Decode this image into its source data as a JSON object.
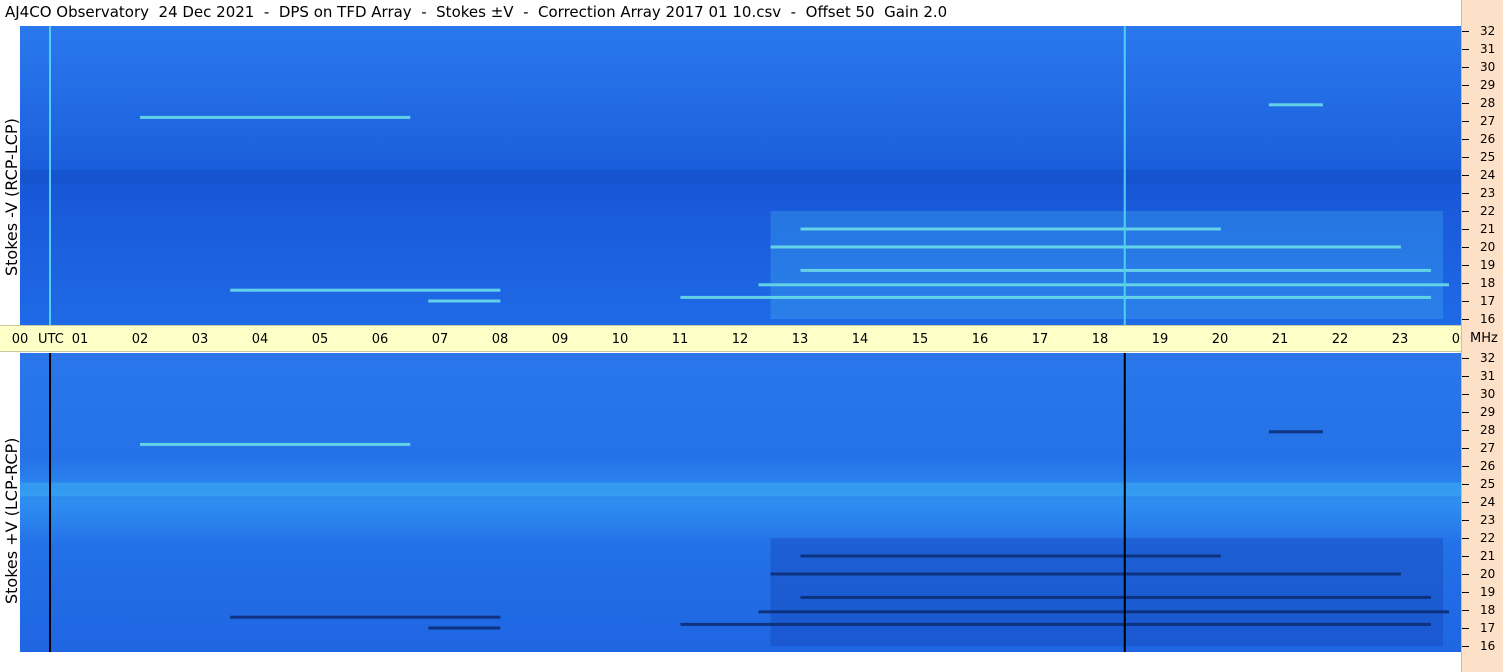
{
  "title": "AJ4CO Observatory  24 Dec 2021  -  DPS on TFD Array  -  Stokes ±V  -  Correction Array 2017 01 10.csv  -  Offset 50  Gain 2.0",
  "panels": [
    {
      "label": "Stokes -V (RCP-LCP)",
      "marker_color": "#4fd0f0",
      "base_color": "#1b62e6"
    },
    {
      "label": "Stokes +V (LCP-RCP)",
      "marker_color": "#000000",
      "base_color": "#1b62e6"
    }
  ],
  "time_axis": {
    "unit_label": "UTC",
    "hours": [
      "00",
      "01",
      "02",
      "03",
      "04",
      "05",
      "06",
      "07",
      "08",
      "09",
      "10",
      "11",
      "12",
      "13",
      "14",
      "15",
      "16",
      "17",
      "18",
      "19",
      "20",
      "21",
      "22",
      "23",
      "00"
    ]
  },
  "freq_axis": {
    "unit_label": "MHz",
    "labels": [
      "32",
      "31",
      "30",
      "29",
      "28",
      "27",
      "26",
      "25",
      "24",
      "23",
      "22",
      "21",
      "20",
      "19",
      "18",
      "17",
      "16"
    ]
  },
  "chart_data": [
    {
      "type": "heatmap",
      "title": "Stokes -V (RCP-LCP)",
      "xlabel": "UTC",
      "ylabel": "MHz",
      "xlim": [
        0,
        24
      ],
      "ylim": [
        16,
        32
      ],
      "marker_lines_utc": [
        0.5,
        18.4
      ],
      "bands": [
        {
          "utc": [
            0.0,
            24.0
          ],
          "mhz": 23.9,
          "level": "low"
        },
        {
          "utc": [
            3.5,
            8.0
          ],
          "mhz": 17.6,
          "level": "high"
        },
        {
          "utc": [
            6.8,
            8.0
          ],
          "mhz": 17.0,
          "level": "high"
        },
        {
          "utc": [
            12.3,
            23.8
          ],
          "mhz": 17.9,
          "level": "high"
        },
        {
          "utc": [
            11.0,
            23.5
          ],
          "mhz": 17.2,
          "level": "high"
        },
        {
          "utc": [
            13.0,
            23.5
          ],
          "mhz": 18.7,
          "level": "high"
        },
        {
          "utc": [
            12.5,
            23.0
          ],
          "mhz": 20.0,
          "level": "high"
        },
        {
          "utc": [
            13.0,
            20.0
          ],
          "mhz": 21.0,
          "level": "high"
        },
        {
          "utc": [
            20.8,
            21.7
          ],
          "mhz": 27.9,
          "level": "high"
        },
        {
          "utc": [
            2.0,
            6.5
          ],
          "mhz": 27.2,
          "level": "high"
        }
      ]
    },
    {
      "type": "heatmap",
      "title": "Stokes +V (LCP-RCP)",
      "xlabel": "UTC",
      "ylabel": "MHz",
      "xlim": [
        0,
        24
      ],
      "ylim": [
        16,
        32
      ],
      "marker_lines_utc": [
        0.5,
        18.4
      ],
      "bands": [
        {
          "utc": [
            0.0,
            24.0
          ],
          "mhz": 24.7,
          "level": "high"
        },
        {
          "utc": [
            3.5,
            8.0
          ],
          "mhz": 17.6,
          "level": "low"
        },
        {
          "utc": [
            6.8,
            8.0
          ],
          "mhz": 17.0,
          "level": "low"
        },
        {
          "utc": [
            12.3,
            23.8
          ],
          "mhz": 17.9,
          "level": "low"
        },
        {
          "utc": [
            11.0,
            23.5
          ],
          "mhz": 17.2,
          "level": "low"
        },
        {
          "utc": [
            13.0,
            23.5
          ],
          "mhz": 18.7,
          "level": "low"
        },
        {
          "utc": [
            12.5,
            23.0
          ],
          "mhz": 20.0,
          "level": "low"
        },
        {
          "utc": [
            13.0,
            20.0
          ],
          "mhz": 21.0,
          "level": "low"
        },
        {
          "utc": [
            20.8,
            21.7
          ],
          "mhz": 27.9,
          "level": "low"
        },
        {
          "utc": [
            2.0,
            6.5
          ],
          "mhz": 27.2,
          "level": "high"
        }
      ]
    }
  ]
}
